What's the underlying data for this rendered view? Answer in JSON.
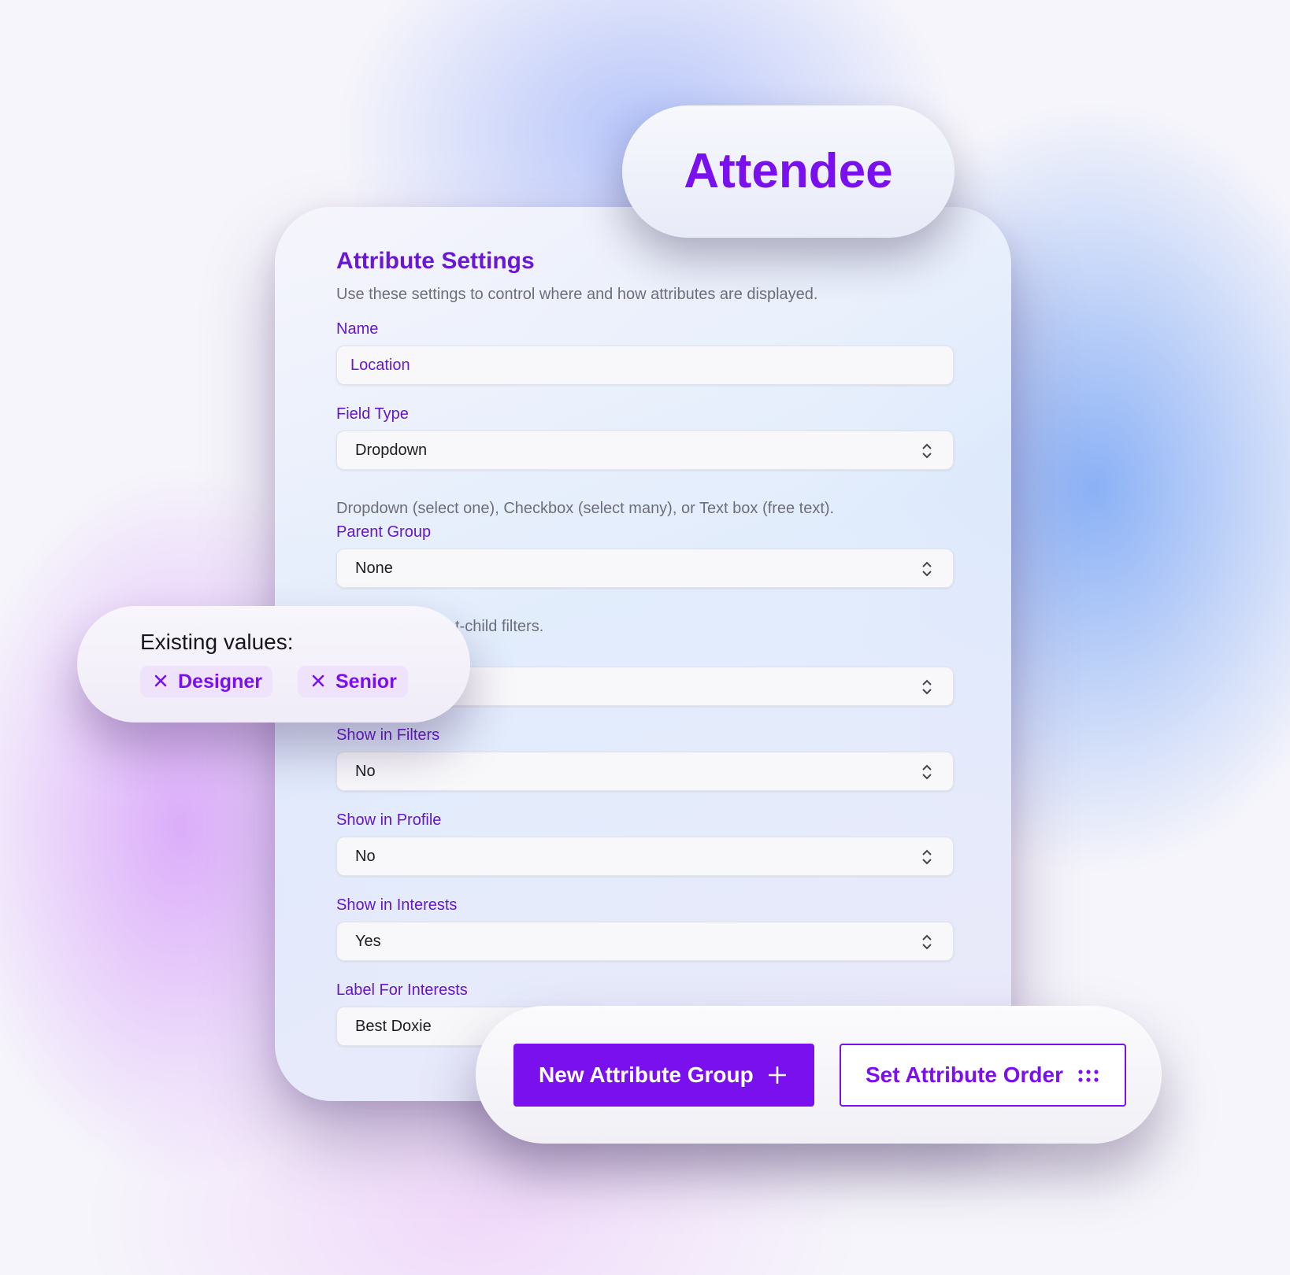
{
  "badge": {
    "title": "Attendee"
  },
  "settings": {
    "title": "Attribute Settings",
    "description": "Use these settings to control where and how attributes are displayed.",
    "name": {
      "label": "Name",
      "value": "Location"
    },
    "field_type": {
      "label": "Field Type",
      "value": "Dropdown",
      "hint": "Dropdown (select one), Checkbox (select many), or Text box (free text)."
    },
    "parent_group": {
      "label": "Parent Group",
      "value": "None",
      "hint_visible": "t-child filters."
    },
    "show_in_filters": {
      "label": "Show in Filters",
      "value": "No"
    },
    "show_in_profile": {
      "label": "Show in Profile",
      "value": "No"
    },
    "show_in_interests": {
      "label": "Show in Interests",
      "value": "Yes"
    },
    "label_for_interests": {
      "label": "Label For Interests",
      "value": "Best Doxie"
    }
  },
  "existing_values": {
    "title": "Existing values:",
    "chips": [
      "Designer",
      "Senior"
    ]
  },
  "actions": {
    "new_group_label": "New Attribute Group",
    "set_order_label": "Set Attribute Order"
  },
  "icons": {
    "select": "chevron-up-down-icon",
    "remove": "close-icon",
    "add": "plus-icon",
    "order": "drag-dots-icon"
  },
  "colors": {
    "accent": "#7a10ee",
    "label": "#6417cc",
    "chip_bg": "#efe2fb"
  }
}
